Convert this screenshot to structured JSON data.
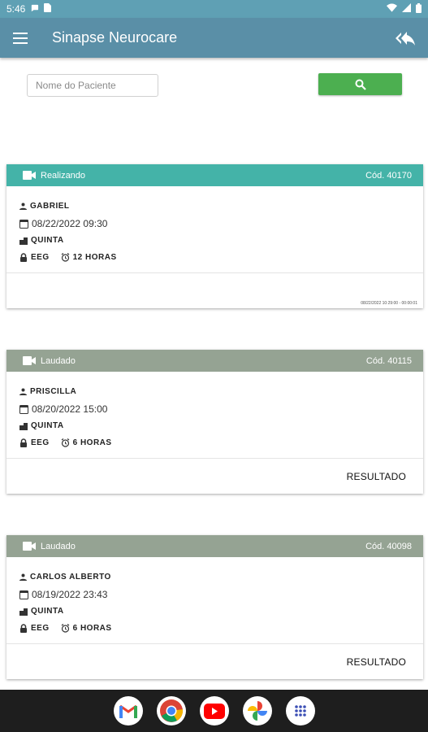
{
  "status_bar": {
    "time": "5:46"
  },
  "app_bar": {
    "title": "Sinapse Neurocare"
  },
  "search": {
    "placeholder": "Nome do Paciente",
    "value": ""
  },
  "cards": [
    {
      "status": "Realizando",
      "code": "Cód. 40170",
      "patient": "GABRIEL",
      "datetime": "08/22/2022 09:30",
      "unit": "QUINTA",
      "exam": "EEG",
      "duration": "12 HORAS",
      "footer_note": "08/22/2022 10:29:00 - 00:00:01",
      "action": "",
      "header_color": "#44b3a8"
    },
    {
      "status": "Laudado",
      "code": "Cód. 40115",
      "patient": "PRISCILLA",
      "datetime": "08/20/2022 15:00",
      "unit": "QUINTA",
      "exam": "EEG",
      "duration": "6 HORAS",
      "footer_note": "",
      "action": "RESULTADO",
      "header_color": "#95a393"
    },
    {
      "status": "Laudado",
      "code": "Cód. 40098",
      "patient": "CARLOS ALBERTO",
      "datetime": "08/19/2022 23:43",
      "unit": "QUINTA",
      "exam": "EEG",
      "duration": "6 HORAS",
      "footer_note": "",
      "action": "RESULTADO",
      "header_color": "#95a393"
    }
  ],
  "dock": {
    "apps": [
      "gmail-icon",
      "chrome-icon",
      "youtube-icon",
      "photos-icon",
      "app-drawer-icon"
    ]
  }
}
